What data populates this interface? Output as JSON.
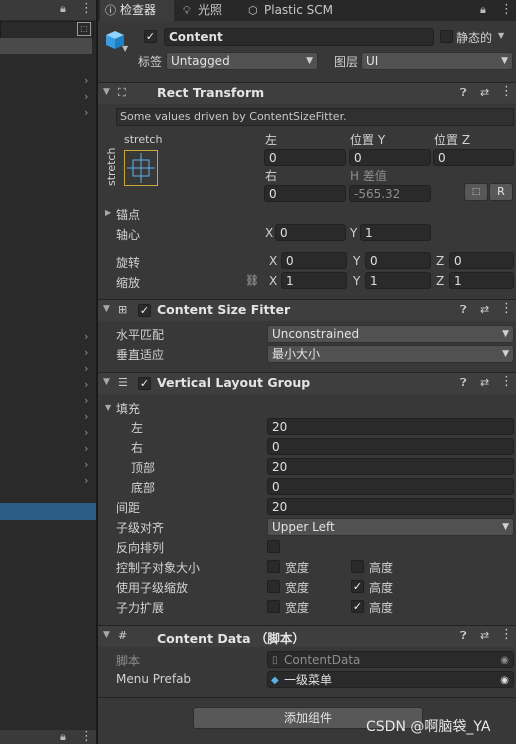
{
  "tabs": [
    {
      "label": "检查器",
      "icon": "info-icon"
    },
    {
      "label": "光照",
      "icon": "lightbulb-icon"
    },
    {
      "label": "Plastic SCM",
      "icon": "plastic-scm-icon"
    }
  ],
  "object": {
    "name": "Content",
    "static_label": "静态的",
    "tag_label": "标签",
    "tag_value": "Untagged",
    "layer_label": "图层",
    "layer_value": "UI",
    "active": true
  },
  "rect_transform": {
    "title": "Rect Transform",
    "notice": "Some values driven by ContentSizeFitter.",
    "anchor_h": "stretch",
    "anchor_v": "stretch",
    "left_label": "左",
    "pos_y_label": "位置 Y",
    "pos_z_label": "位置 Z",
    "left": "0",
    "pos_y": "0",
    "pos_z": "0",
    "right_label": "右",
    "height_label": "H 差值",
    "right": "0",
    "height": "-565.32",
    "raw_button": "R",
    "anchors_label": "锚点",
    "pivot_label": "轴心",
    "pivot_x": "0",
    "pivot_y": "1",
    "rotation_label": "旋转",
    "rot_x": "0",
    "rot_y": "0",
    "rot_z": "0",
    "scale_label": "缩放",
    "scale_x": "1",
    "scale_y": "1",
    "scale_z": "1",
    "x": "X",
    "y": "Y",
    "z": "Z"
  },
  "content_size_fitter": {
    "title": "Content Size Fitter",
    "enabled": true,
    "horizontal_label": "水平匹配",
    "horizontal_value": "Unconstrained",
    "vertical_label": "垂直适应",
    "vertical_value": "最小大小"
  },
  "vertical_layout_group": {
    "title": "Vertical Layout Group",
    "enabled": true,
    "padding_label": "填充",
    "left_label": "左",
    "left": "20",
    "right_label": "右",
    "right": "0",
    "top_label": "顶部",
    "top": "20",
    "bottom_label": "底部",
    "bottom": "0",
    "spacing_label": "间距",
    "spacing": "20",
    "child_alignment_label": "子级对齐",
    "child_alignment": "Upper Left",
    "reverse_label": "反向排列",
    "control_size_label": "控制子对象大小",
    "use_scale_label": "使用子级缩放",
    "force_expand_label": "子力扩展",
    "width_label": "宽度",
    "height_label": "高度",
    "control_width": false,
    "control_height": false,
    "scale_width": false,
    "scale_height": true,
    "expand_width": false,
    "expand_height": true
  },
  "content_data": {
    "title": "Content Data （脚本）",
    "script_label": "脚本",
    "script_value": "ContentData",
    "prefab_label": "Menu Prefab",
    "prefab_value": "一级菜单"
  },
  "add_component_button": "添加组件",
  "watermark": "CSDN @啊脑袋_YA"
}
